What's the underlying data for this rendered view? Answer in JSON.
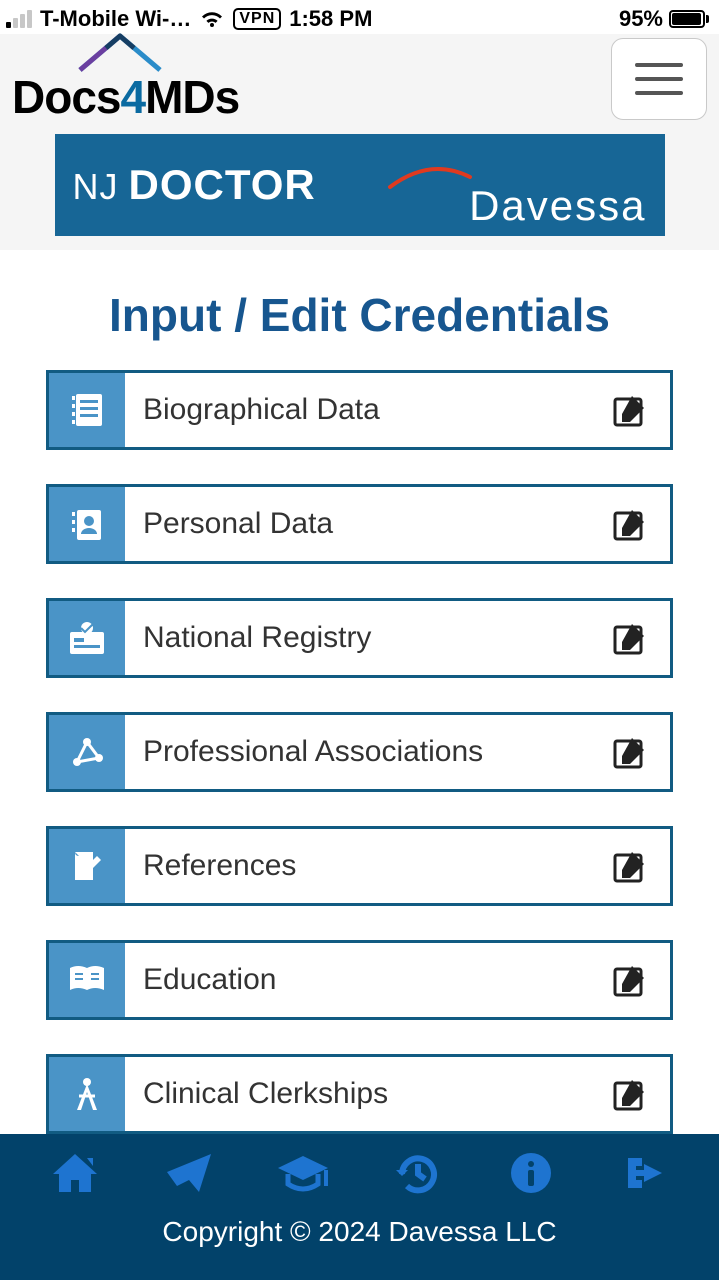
{
  "status": {
    "carrier": "T-Mobile Wi-…",
    "vpn": "VPN",
    "time": "1:58 PM",
    "battery_pct": "95%"
  },
  "header": {
    "logo_docs": "Docs",
    "logo_four": "4",
    "logo_mds": "MDs",
    "banner_nj": "NJ",
    "banner_doctor": "DOCTOR",
    "banner_brand": "Davessa"
  },
  "page": {
    "title": "Input / Edit Credentials"
  },
  "credentials": [
    {
      "label": "Biographical Data",
      "icon": "notebook-icon"
    },
    {
      "label": "Personal Data",
      "icon": "id-card-icon"
    },
    {
      "label": "National Registry",
      "icon": "badge-card-icon"
    },
    {
      "label": "Professional Associations",
      "icon": "network-icon"
    },
    {
      "label": "References",
      "icon": "clipboard-pen-icon"
    },
    {
      "label": "Education",
      "icon": "book-open-icon"
    },
    {
      "label": "Clinical Clerkships",
      "icon": "compass-icon"
    }
  ],
  "footer": {
    "copyright": "Copyright © 2024 Davessa LLC"
  }
}
